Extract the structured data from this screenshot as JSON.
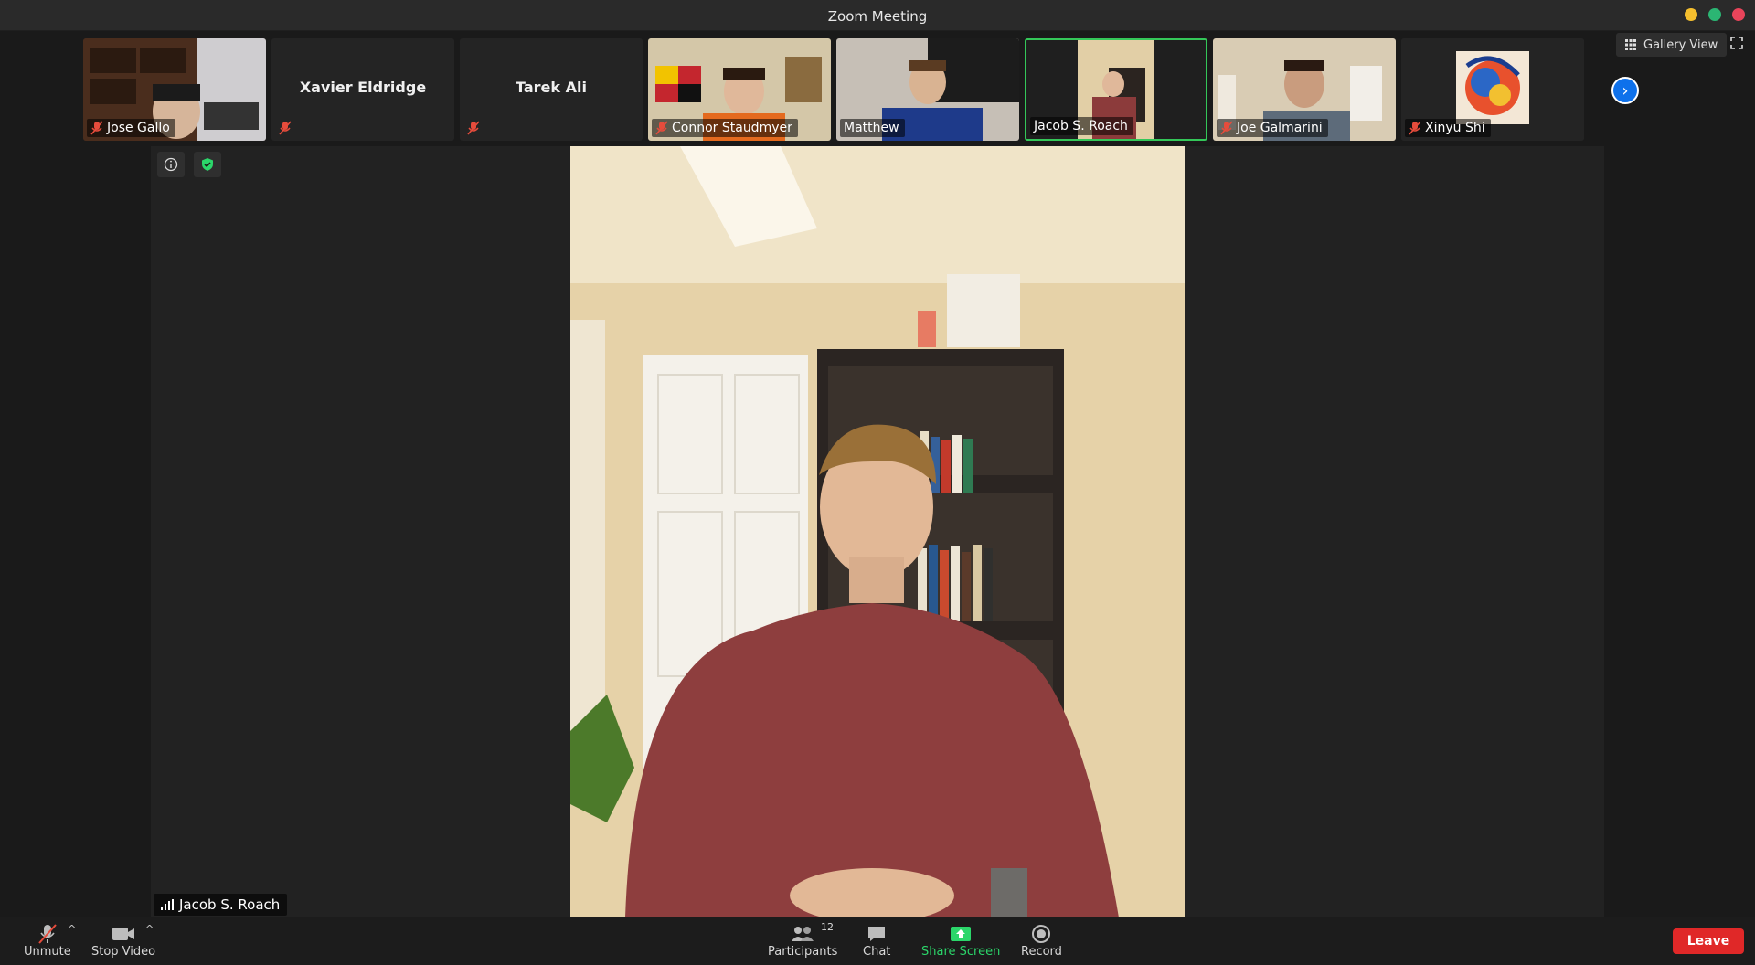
{
  "window": {
    "title": "Zoom Meeting"
  },
  "view": {
    "gallery_label": "Gallery View"
  },
  "participants": [
    {
      "name": "Jose Gallo",
      "muted": true,
      "video": true
    },
    {
      "name": "Xavier Eldridge",
      "muted": true,
      "video": false
    },
    {
      "name": "Tarek Ali",
      "muted": true,
      "video": false
    },
    {
      "name": "Connor Staudmyer",
      "muted": true,
      "video": true
    },
    {
      "name": "Matthew",
      "muted": false,
      "video": true
    },
    {
      "name": "Jacob S. Roach",
      "muted": false,
      "video": true,
      "active_speaker": true
    },
    {
      "name": "Joe Galmarini",
      "muted": true,
      "video": true
    },
    {
      "name": "Xinyu Shi",
      "muted": true,
      "video": true
    }
  ],
  "main": {
    "speaker_name": "Jacob S. Roach"
  },
  "toolbar": {
    "unmute_label": "Unmute",
    "stop_video_label": "Stop Video",
    "participants_label": "Participants",
    "participants_count": "12",
    "chat_label": "Chat",
    "share_screen_label": "Share Screen",
    "record_label": "Record",
    "leave_label": "Leave"
  },
  "colors": {
    "active_border": "#34c759",
    "leave": "#e02828",
    "share": "#2bd66a",
    "next_page": "#0e71eb"
  }
}
